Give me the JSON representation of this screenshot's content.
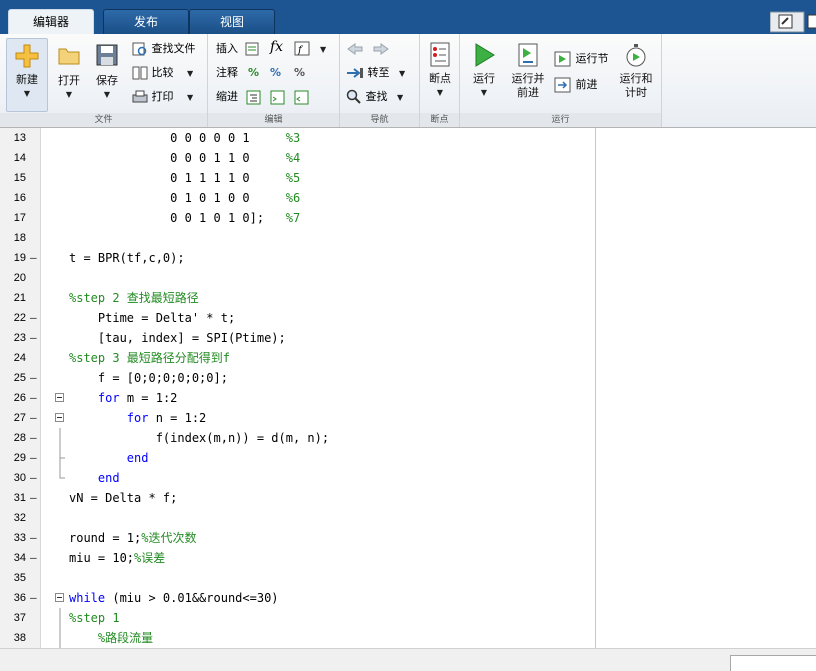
{
  "tabs": [
    {
      "label": "编辑器",
      "active": true
    },
    {
      "label": "发布",
      "active": false
    },
    {
      "label": "视图",
      "active": false
    }
  ],
  "ribbon": {
    "file": {
      "section_label": "文件",
      "new_label": "新建",
      "open_label": "打开",
      "save_label": "保存",
      "find_files_label": "查找文件",
      "compare_label": "比较",
      "print_label": "打印"
    },
    "edit": {
      "section_label": "编辑",
      "insert_label": "插入",
      "comment_label": "注释",
      "indent_label": "缩进",
      "fx_label": "fx"
    },
    "nav": {
      "section_label": "导航",
      "goto_label": "转至",
      "find_label": "查找"
    },
    "breakpoints": {
      "section_label": "断点",
      "breakpoint_label": "断点"
    },
    "run": {
      "section_label": "运行",
      "run_label": "运行",
      "run_advance_label": "运行并\n前进",
      "run_section_label": "运行节",
      "advance_label": "前进",
      "run_time_label": "运行和\n计时"
    }
  },
  "code_lines": [
    {
      "n": "13",
      "dash": false,
      "fold": "",
      "text": "              0 0 0 0 0 1     %3"
    },
    {
      "n": "14",
      "dash": false,
      "fold": "",
      "text": "              0 0 0 1 1 0     %4"
    },
    {
      "n": "15",
      "dash": false,
      "fold": "",
      "text": "              0 1 1 1 1 0     %5"
    },
    {
      "n": "16",
      "dash": false,
      "fold": "",
      "text": "              0 1 0 1 0 0     %6"
    },
    {
      "n": "17",
      "dash": false,
      "fold": "",
      "text": "              0 0 1 0 1 0];   %7"
    },
    {
      "n": "18",
      "dash": false,
      "fold": "",
      "text": ""
    },
    {
      "n": "19",
      "dash": true,
      "fold": "",
      "text": "t = BPR(tf,c,0);"
    },
    {
      "n": "20",
      "dash": false,
      "fold": "",
      "text": ""
    },
    {
      "n": "21",
      "dash": false,
      "fold": "",
      "text": "%step 2 查找最短路径"
    },
    {
      "n": "22",
      "dash": true,
      "fold": "",
      "text": "    Ptime = Delta' * t;"
    },
    {
      "n": "23",
      "dash": true,
      "fold": "",
      "text": "    [tau, index] = SPI(Ptime);"
    },
    {
      "n": "24",
      "dash": false,
      "fold": "",
      "text": "%step 3 最短路径分配得到f"
    },
    {
      "n": "25",
      "dash": true,
      "fold": "",
      "text": "    f = [0;0;0;0;0;0];"
    },
    {
      "n": "26",
      "dash": true,
      "fold": "box",
      "text": "    for m = 1:2"
    },
    {
      "n": "27",
      "dash": true,
      "fold": "box",
      "text": "        for n = 1:2"
    },
    {
      "n": "28",
      "dash": true,
      "fold": "line",
      "text": "            f(index(m,n)) = d(m, n);"
    },
    {
      "n": "29",
      "dash": true,
      "fold": "end",
      "text": "        end"
    },
    {
      "n": "30",
      "dash": true,
      "fold": "end2",
      "text": "    end"
    },
    {
      "n": "31",
      "dash": true,
      "fold": "",
      "text": "vN = Delta * f;"
    },
    {
      "n": "32",
      "dash": false,
      "fold": "",
      "text": ""
    },
    {
      "n": "33",
      "dash": true,
      "fold": "",
      "text": "round = 1;%迭代次数"
    },
    {
      "n": "34",
      "dash": true,
      "fold": "",
      "text": "miu = 10;%误差"
    },
    {
      "n": "35",
      "dash": false,
      "fold": "",
      "text": ""
    },
    {
      "n": "36",
      "dash": true,
      "fold": "box",
      "text": "while (miu > 0.01&&round<=30)"
    },
    {
      "n": "37",
      "dash": false,
      "fold": "line",
      "text": "%step 1"
    },
    {
      "n": "38",
      "dash": false,
      "fold": "line",
      "text": "    %路段流量"
    }
  ],
  "colors": {
    "tab_bar": "#1c5592",
    "keyword": "#0000ff",
    "comment": "#228b22"
  }
}
